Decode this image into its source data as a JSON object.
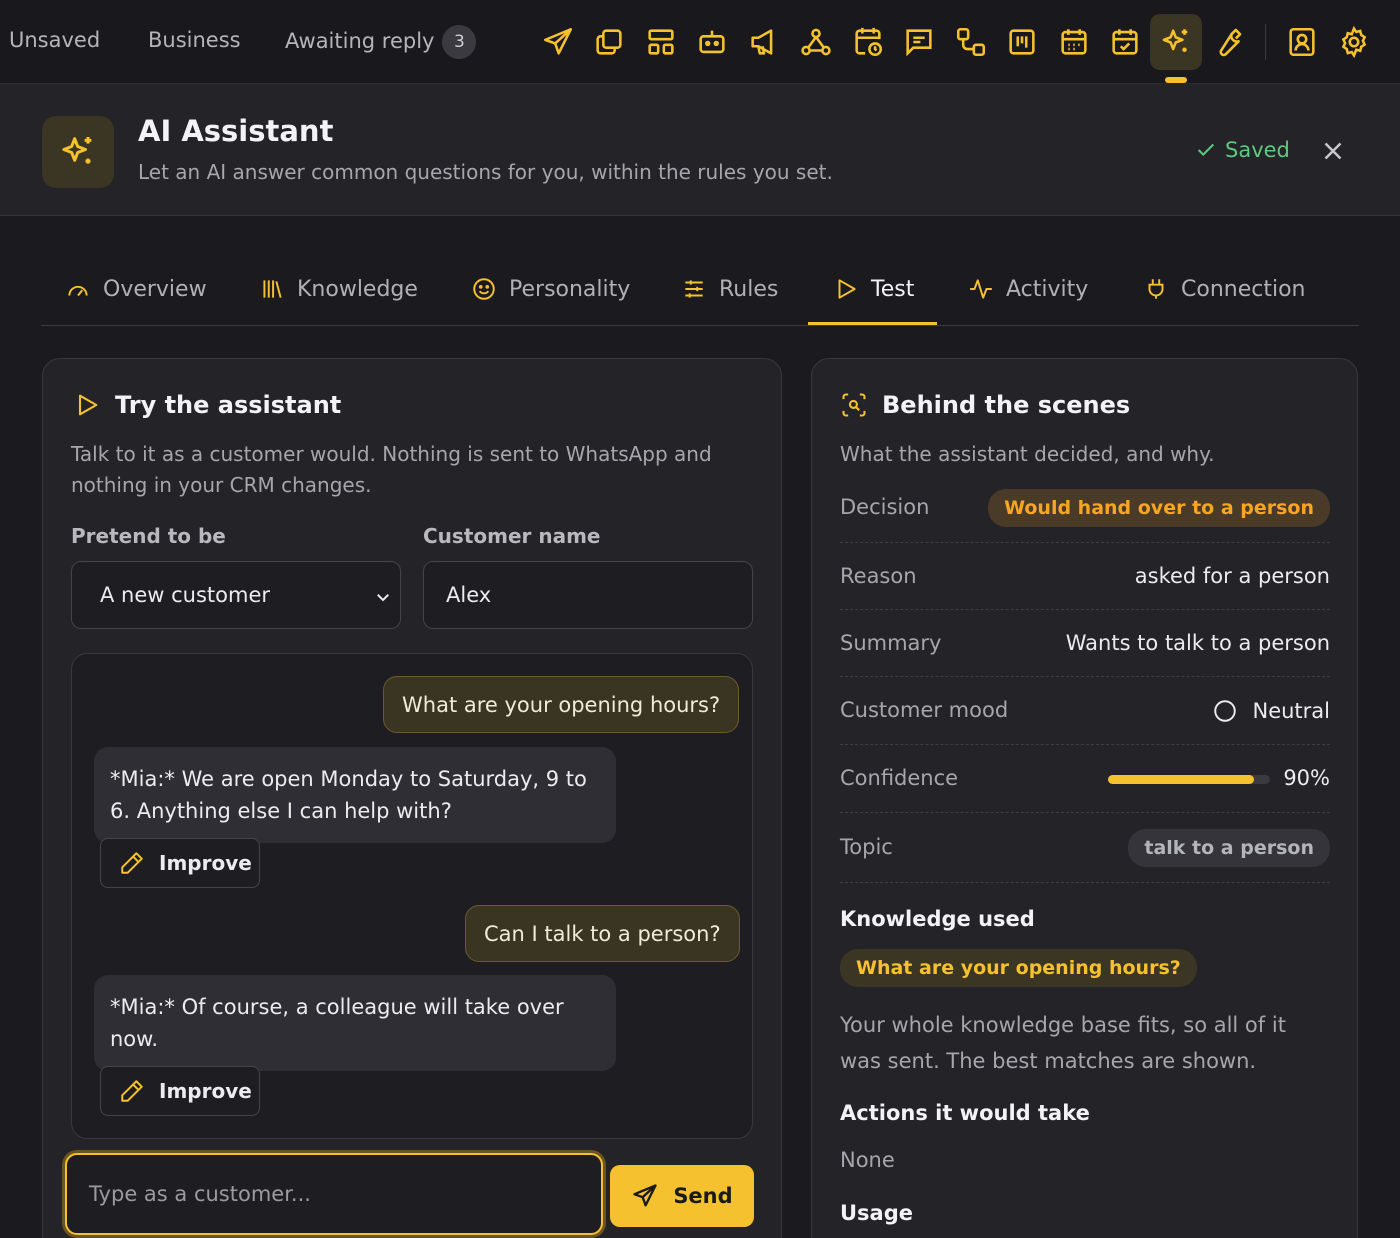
{
  "topnav": {
    "unsaved": "Unsaved",
    "business": "Business",
    "awaiting": "Awaiting reply",
    "awaiting_count": "3",
    "icons": [
      "send-icon",
      "copy-icon",
      "layout-icon",
      "bot-icon",
      "megaphone-icon",
      "webhook-icon",
      "calendar-clock-icon",
      "message-icon",
      "flow-icon",
      "kanban-icon",
      "calendar-icon",
      "calendar-check-icon",
      "sparkles-icon",
      "wrench-icon",
      "contact-icon",
      "gear-icon"
    ],
    "active_icon": "sparkles-icon"
  },
  "header": {
    "title": "AI Assistant",
    "subtitle": "Let an AI answer common questions for you, within the rules you set.",
    "saved": "Saved"
  },
  "tabs": {
    "overview": "Overview",
    "knowledge": "Knowledge",
    "personality": "Personality",
    "rules": "Rules",
    "test": "Test",
    "activity": "Activity",
    "connection": "Connection",
    "active": "Test"
  },
  "left": {
    "title": "Try the assistant",
    "desc_line1": "Talk to it as a customer would. Nothing is sent to WhatsApp and",
    "desc_line2": "nothing in your CRM changes.",
    "pretend_label": "Pretend to be",
    "pretend_value": "A new customer",
    "name_label": "Customer name",
    "name_value": "Alex",
    "messages": [
      {
        "from": "customer",
        "text": "What are your opening hours?"
      },
      {
        "from": "assistant",
        "line1": "*Mia:* We are open Monday to Saturday, 9 to",
        "line2": "6. Anything else I can help with?"
      },
      {
        "from": "customer",
        "text": "Can I talk to a person?"
      },
      {
        "from": "assistant",
        "line1": "*Mia:* Of course, a colleague will take over",
        "line2": "now."
      }
    ],
    "improve_label": "Improve",
    "input_placeholder": "Type as a customer...",
    "send_label": "Send"
  },
  "right": {
    "title": "Behind the scenes",
    "desc": "What the assistant decided, and why.",
    "decision_label": "Decision",
    "decision_value": "Would hand over to a person",
    "reason_label": "Reason",
    "reason_value": "asked for a person",
    "summary_label": "Summary",
    "summary_value": "Wants to talk to a person",
    "mood_label": "Customer mood",
    "mood_value": "Neutral",
    "confidence_label": "Confidence",
    "confidence_value": "90%",
    "confidence_fraction": 0.9,
    "topic_label": "Topic",
    "topic_value": "talk to a person",
    "knowledge_title": "Knowledge used",
    "knowledge_item": "What are your opening hours?",
    "knowledge_note_line1": "Your whole knowledge base fits, so all of it",
    "knowledge_note_line2": "was sent. The best matches are shown.",
    "actions_title": "Actions it would take",
    "actions_value": "None",
    "usage_title": "Usage"
  },
  "colors": {
    "accent": "#f6c12e",
    "saved_green": "#5ec97f",
    "decision_orange": "#f5a623"
  }
}
